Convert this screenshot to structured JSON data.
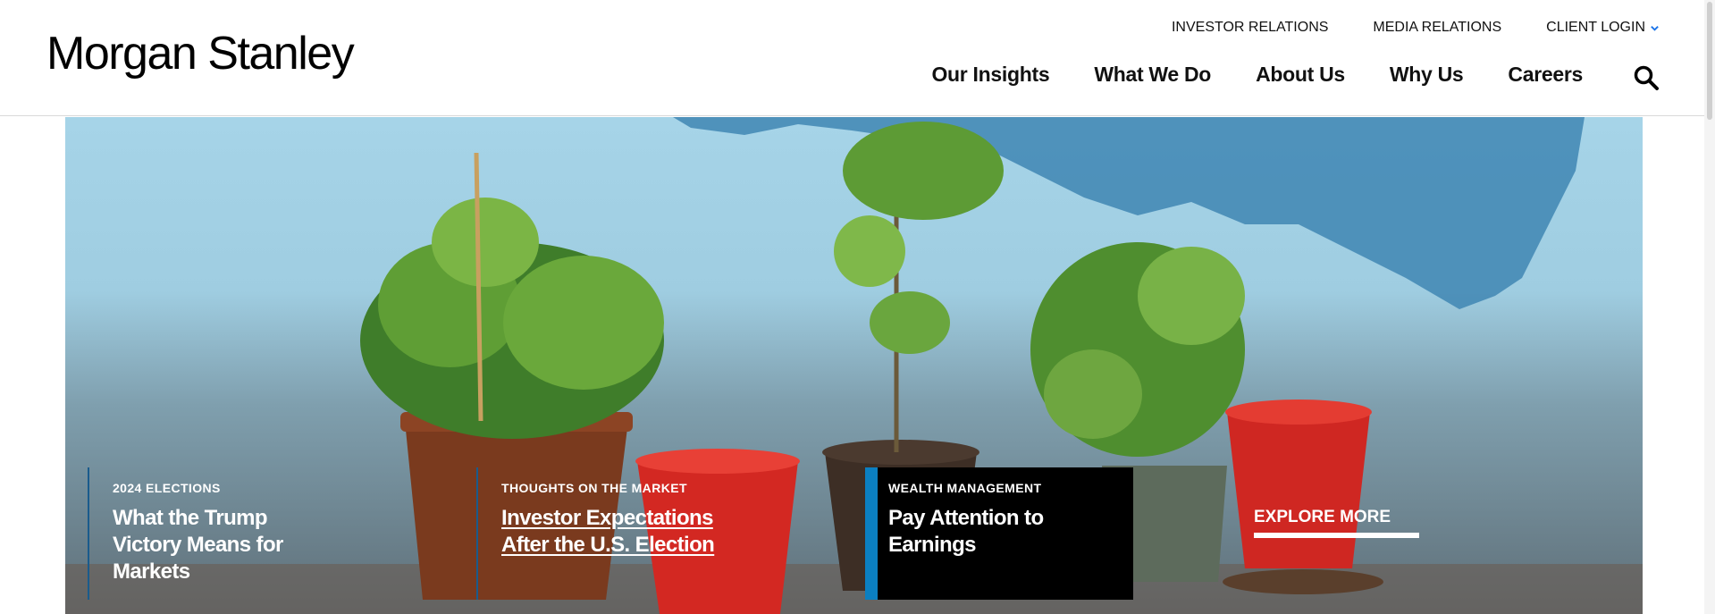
{
  "header": {
    "logo": "Morgan Stanley",
    "utility_links": [
      "INVESTOR RELATIONS",
      "MEDIA RELATIONS"
    ],
    "client_login": "CLIENT LOGIN",
    "nav": [
      "Our Insights",
      "What We Do",
      "About Us",
      "Why Us",
      "Careers"
    ],
    "search_icon": "search-icon",
    "chevron_icon": "chevron-down-icon",
    "accent_color": "#1a73e8"
  },
  "hero": {
    "cards": [
      {
        "kicker": "2024 ELECTIONS",
        "title": "What the Trump Victory Means for Markets"
      },
      {
        "kicker": "THOUGHTS ON THE MARKET",
        "title": "Investor Expectations After the U.S. Election"
      },
      {
        "kicker": "WEALTH MANAGEMENT",
        "title": "Pay Attention to Earnings"
      }
    ],
    "explore": "EXPLORE MORE",
    "highlight_color": "#0b7fc1"
  }
}
